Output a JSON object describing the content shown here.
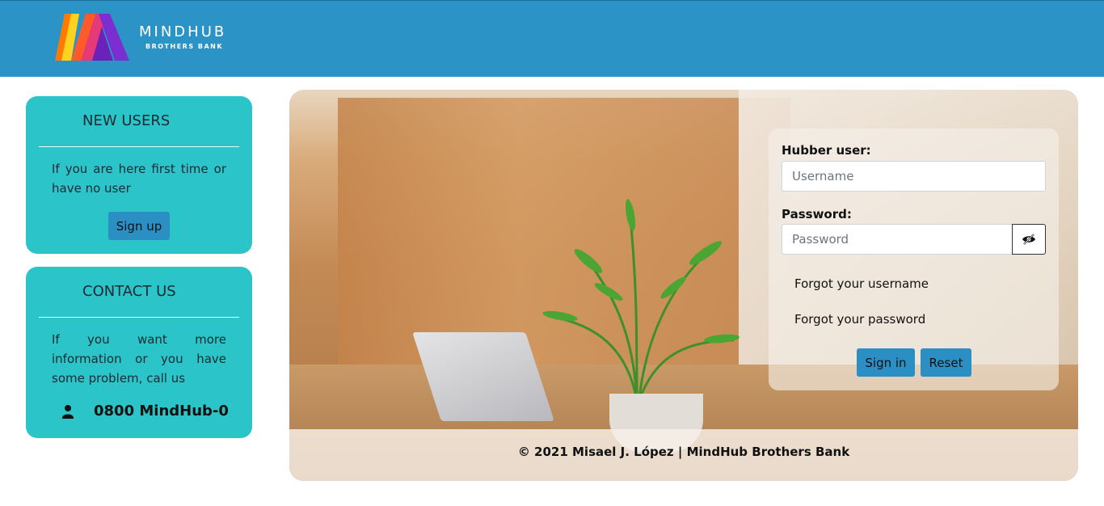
{
  "header": {
    "brand": "MINDHUB",
    "brand_sub": "BROTHERS BANK",
    "logo_colors": [
      "#ffd21f",
      "#ff6a00",
      "#e53a77",
      "#7b2fd0"
    ]
  },
  "new_users": {
    "title": "NEW USERS",
    "text": "If you are here first time or have no user",
    "button": "Sign up"
  },
  "contact": {
    "title": "CONTACT US",
    "text": "If you want more information or you have some problem, call us",
    "phone": "0800 MindHub-0",
    "icon": "user-icon"
  },
  "login": {
    "user_label": "Hubber user:",
    "user_placeholder": "Username",
    "user_value": "",
    "password_label": "Password:",
    "password_placeholder": "Password",
    "password_value": "",
    "toggle_icon": "eye-slash-icon",
    "forgot_username": "Forgot your username",
    "forgot_password": "Forgot your password",
    "sign_in": "Sign in",
    "reset": "Reset"
  },
  "footer": {
    "text": "© 2021 Misael J. López | MindHub Brothers Bank"
  },
  "colors": {
    "header_bg": "#2b93c6",
    "card_bg": "#2bc4c8",
    "button_bg": "#2b8fc4"
  }
}
